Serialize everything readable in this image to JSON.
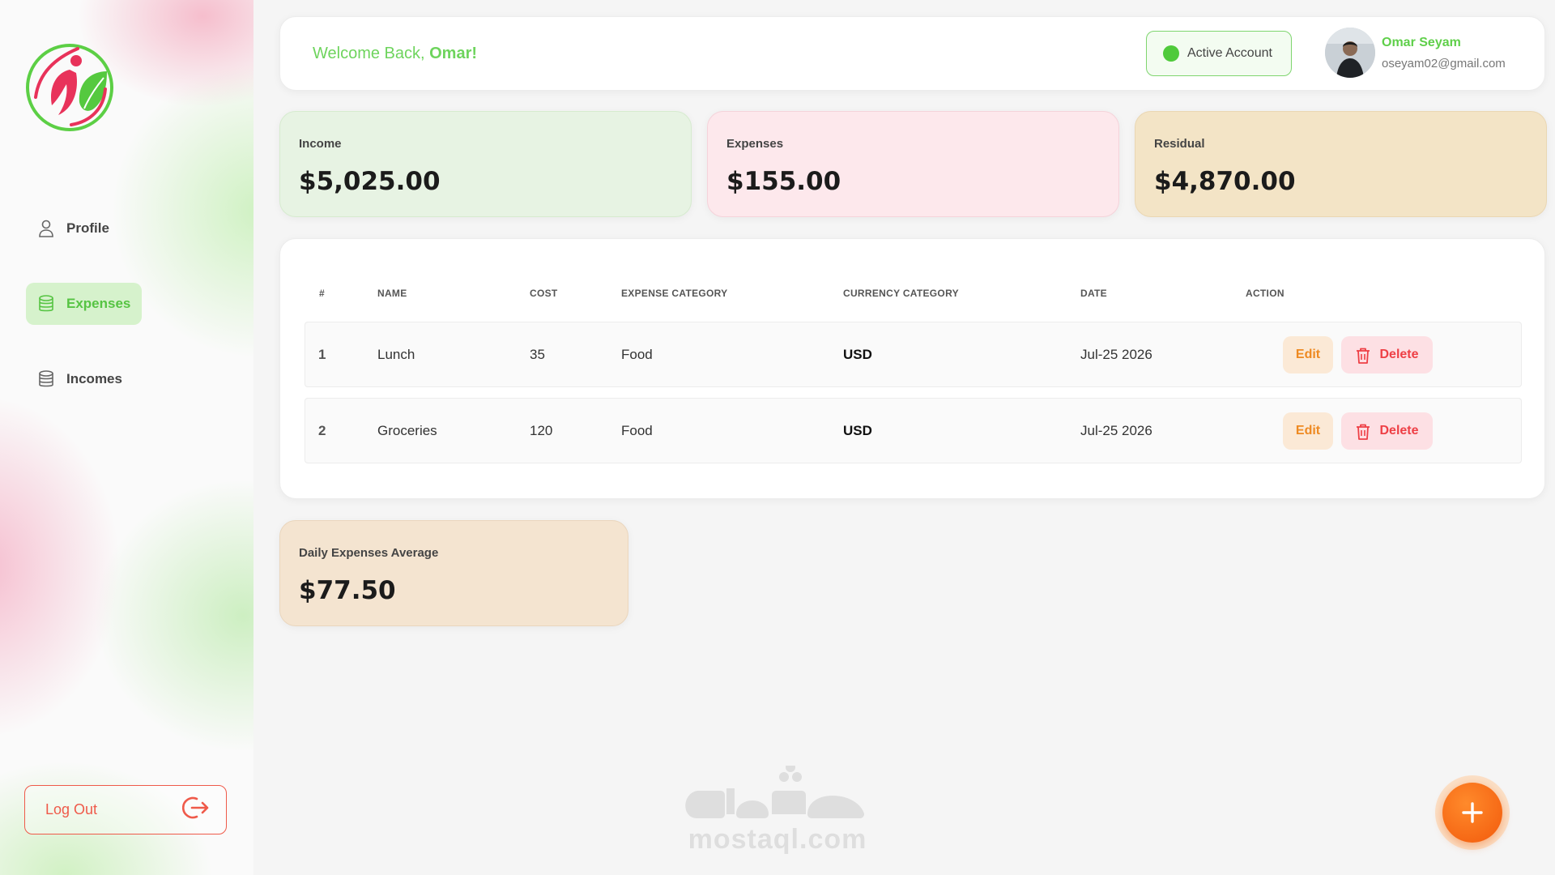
{
  "sidebar": {
    "nav": [
      {
        "label": "Profile",
        "icon": "user-icon"
      },
      {
        "label": "Expenses",
        "icon": "database-icon",
        "active": true
      },
      {
        "label": "Incomes",
        "icon": "database-icon"
      }
    ],
    "logout_label": "Log Out"
  },
  "header": {
    "welcome_prefix": "Welcome Back, ",
    "welcome_name": "Omar!",
    "status_label": "Active Account",
    "user_name": "Omar Seyam",
    "user_email": "oseyam02@gmail.com"
  },
  "stats": {
    "income": {
      "label": "Income",
      "value": "$5,025.00"
    },
    "expenses": {
      "label": "Expenses",
      "value": "$155.00"
    },
    "residual": {
      "label": "Residual",
      "value": "$4,870.00"
    }
  },
  "table": {
    "headers": [
      "#",
      "NAME",
      "COST",
      "EXPENSE CATEGORY",
      "CURRENCY CATEGORY",
      "DATE",
      "ACTION"
    ],
    "rows": [
      {
        "index": "1",
        "name": "Lunch",
        "cost": "35",
        "category": "Food",
        "currency": "USD",
        "date": "Jul-25 2026"
      },
      {
        "index": "2",
        "name": "Groceries",
        "cost": "120",
        "category": "Food",
        "currency": "USD",
        "date": "Jul-25 2026"
      }
    ],
    "edit_label": "Edit",
    "delete_label": "Delete"
  },
  "daily_average": {
    "label": "Daily Expenses Average",
    "value": "$77.50"
  },
  "watermark": {
    "arabic": "مستقل",
    "latin": "mostaql.com"
  },
  "colors": {
    "accent_green": "#5fcf4a",
    "danger_red": "#ee3f45",
    "edit_orange": "#ee8a22",
    "fab_orange": "#f25a0c"
  }
}
